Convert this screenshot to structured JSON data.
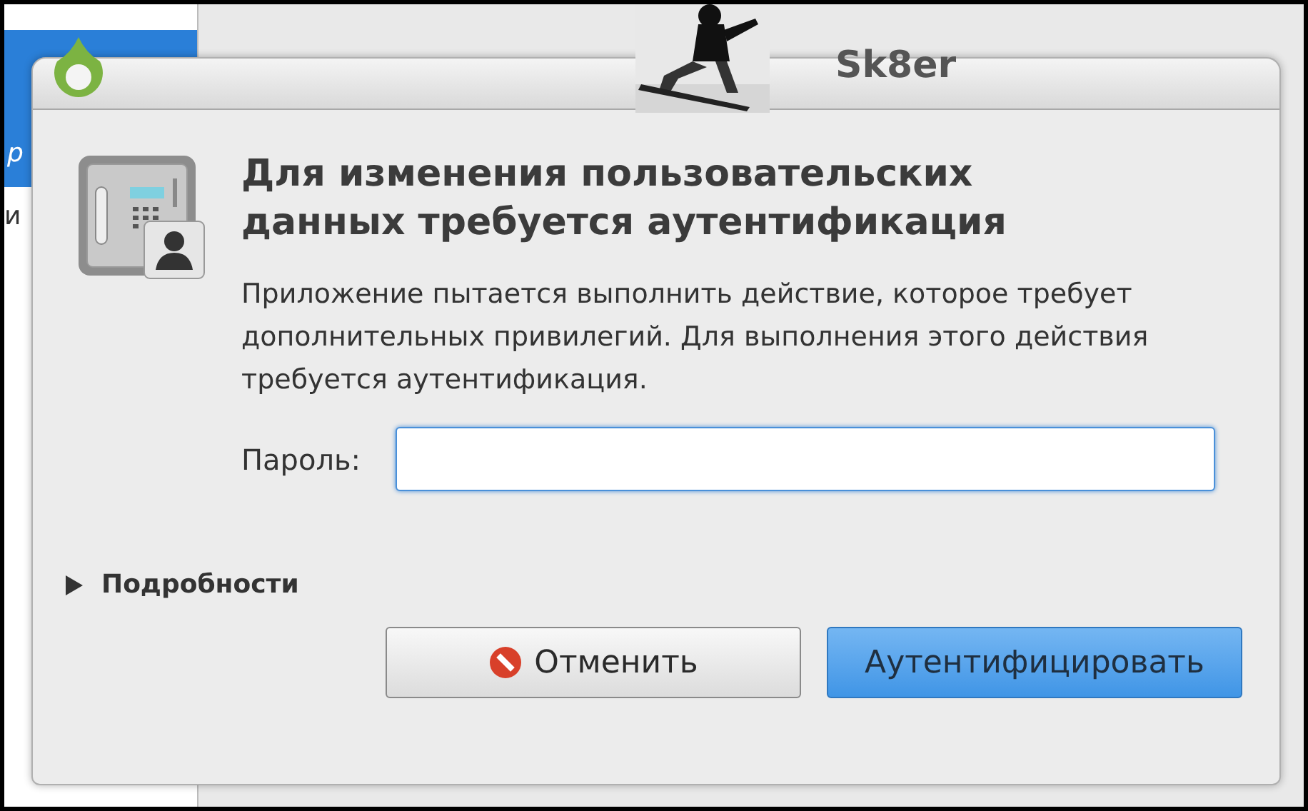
{
  "background": {
    "sidebar_texts": [
      "р",
      "и"
    ],
    "window_title": "Sk8er"
  },
  "dialog": {
    "heading": "Для изменения пользовательских данных требуется аутентификация",
    "message": "Приложение пытается выполнить действие, которое требует дополнительных привилегий. Для выполнения этого действия требуется аутентификация.",
    "password": {
      "label": "Пароль:",
      "focused": true
    },
    "details": {
      "label": "Подробности",
      "expanded": false
    },
    "buttons": [
      {
        "label": "Отменить",
        "kind": "cancel"
      },
      {
        "label": "Аутентифицировать",
        "kind": "default"
      }
    ]
  }
}
